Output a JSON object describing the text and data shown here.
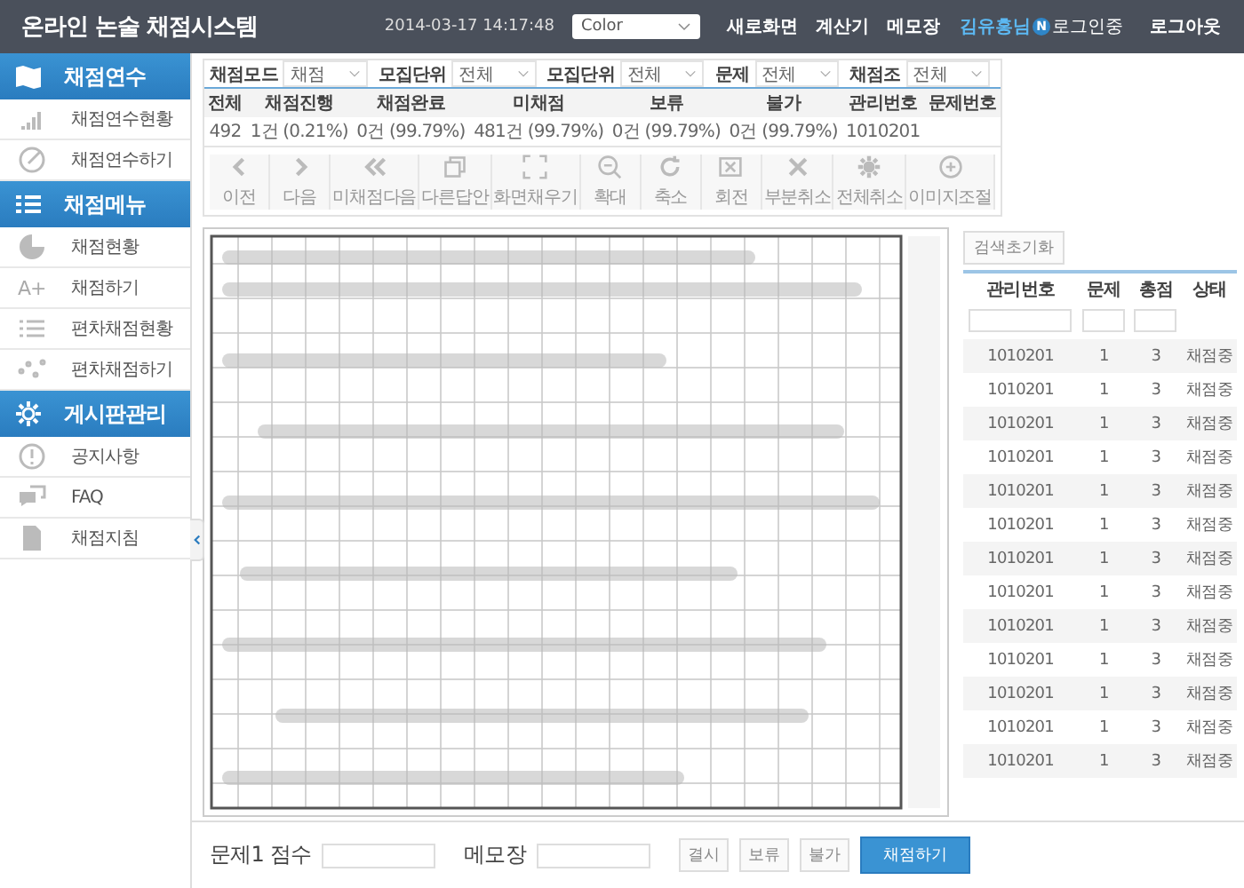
{
  "header": {
    "title": "온라인 논술 채점시스템",
    "datetime": "2014-03-17 14:17:48",
    "color_select": {
      "value": "Color"
    },
    "links": [
      "새로화면",
      "계산기",
      "메모장"
    ],
    "user": "김유홍님",
    "badge": "N",
    "login_state": "로그인중",
    "logout": "로그아웃"
  },
  "sidebar": {
    "sections": [
      {
        "title": "채점연수",
        "items": [
          {
            "label": "채점연수현황"
          },
          {
            "label": "채점연수하기"
          }
        ]
      },
      {
        "title": "채점메뉴",
        "items": [
          {
            "label": "채점현황"
          },
          {
            "label": "채점하기",
            "icon_text": "A+"
          },
          {
            "label": "편차채점현황"
          },
          {
            "label": "편차채점하기"
          }
        ]
      },
      {
        "title": "게시판관리",
        "items": [
          {
            "label": "공지사항"
          },
          {
            "label": "FAQ"
          },
          {
            "label": "채점지침"
          }
        ]
      }
    ]
  },
  "filters": [
    {
      "label": "채점모드",
      "value": "채점"
    },
    {
      "label": "모집단위",
      "value": "전체"
    },
    {
      "label": "모집단위",
      "value": "전체"
    },
    {
      "label": "문제",
      "value": "전체"
    },
    {
      "label": "채점조",
      "value": "전체"
    }
  ],
  "stats": {
    "columns": [
      "전체",
      "채점진행",
      "채점완료",
      "미채점",
      "보류",
      "불가",
      "관리번호",
      "문제번호"
    ],
    "values": [
      "492",
      "1건 (0.21%)",
      "0건 (99.79%)",
      "481건 (99.79%)",
      "0건 (99.79%)",
      "0건 (99.79%)",
      "1010201"
    ]
  },
  "toolbar": [
    "이전",
    "다음",
    "미채점다음",
    "다른답안",
    "화면채우기",
    "확대",
    "축소",
    "회전",
    "부분취소",
    "전체취소",
    "이미지조절"
  ],
  "result_list": {
    "reset_button": "검색초기화",
    "columns": [
      "관리번호",
      "문제",
      "총점",
      "상태"
    ],
    "rows": [
      [
        "1010201",
        "1",
        "3",
        "채점중"
      ],
      [
        "1010201",
        "1",
        "3",
        "채점중"
      ],
      [
        "1010201",
        "1",
        "3",
        "채점중"
      ],
      [
        "1010201",
        "1",
        "3",
        "채점중"
      ],
      [
        "1010201",
        "1",
        "3",
        "채점중"
      ],
      [
        "1010201",
        "1",
        "3",
        "채점중"
      ],
      [
        "1010201",
        "1",
        "3",
        "채점중"
      ],
      [
        "1010201",
        "1",
        "3",
        "채점중"
      ],
      [
        "1010201",
        "1",
        "3",
        "채점중"
      ],
      [
        "1010201",
        "1",
        "3",
        "채점중"
      ],
      [
        "1010201",
        "1",
        "3",
        "채점중"
      ],
      [
        "1010201",
        "1",
        "3",
        "채점중"
      ],
      [
        "1010201",
        "1",
        "3",
        "채점중"
      ]
    ]
  },
  "score_bar": {
    "score_label": "문제1 점수",
    "memo_label": "메모장",
    "buttons": [
      "결시",
      "보류",
      "불가"
    ],
    "submit": "채점하기"
  }
}
